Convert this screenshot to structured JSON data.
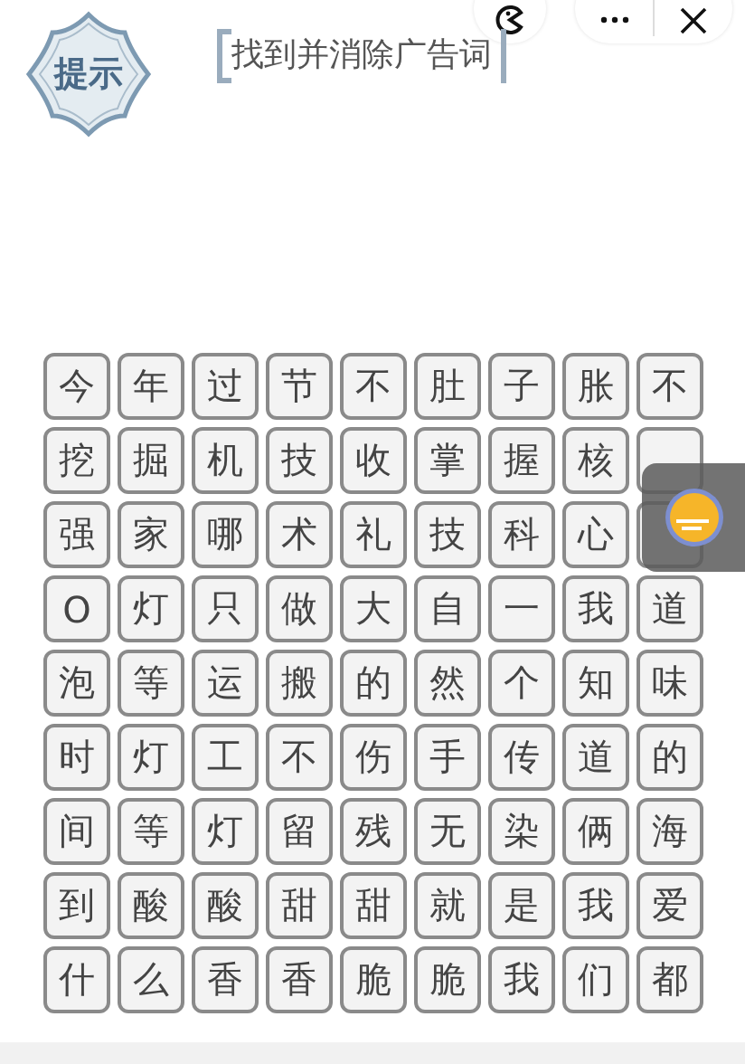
{
  "hint_badge": {
    "label": "提示"
  },
  "title": "找到并消除广告词",
  "grid": {
    "rows": [
      [
        "今",
        "年",
        "过",
        "节",
        "不",
        "肚",
        "子",
        "胀",
        "不"
      ],
      [
        "挖",
        "掘",
        "机",
        "技",
        "收",
        "掌",
        "握",
        "核",
        null
      ],
      [
        "强",
        "家",
        "哪",
        "术",
        "礼",
        "技",
        "科",
        "心",
        null
      ],
      [
        "O",
        "灯",
        "只",
        "做",
        "大",
        "自",
        "一",
        "我",
        "道"
      ],
      [
        "泡",
        "等",
        "运",
        "搬",
        "的",
        "然",
        "个",
        "知",
        "味"
      ],
      [
        "时",
        "灯",
        "工",
        "不",
        "伤",
        "手",
        "传",
        "道",
        "的"
      ],
      [
        "间",
        "等",
        "灯",
        "留",
        "残",
        "无",
        "染",
        "俩",
        "海"
      ],
      [
        "到",
        "酸",
        "酸",
        "甜",
        "甜",
        "就",
        "是",
        "我",
        "爱"
      ],
      [
        "什",
        "么",
        "香",
        "香",
        "脆",
        "脆",
        "我",
        "们",
        "都"
      ]
    ]
  }
}
